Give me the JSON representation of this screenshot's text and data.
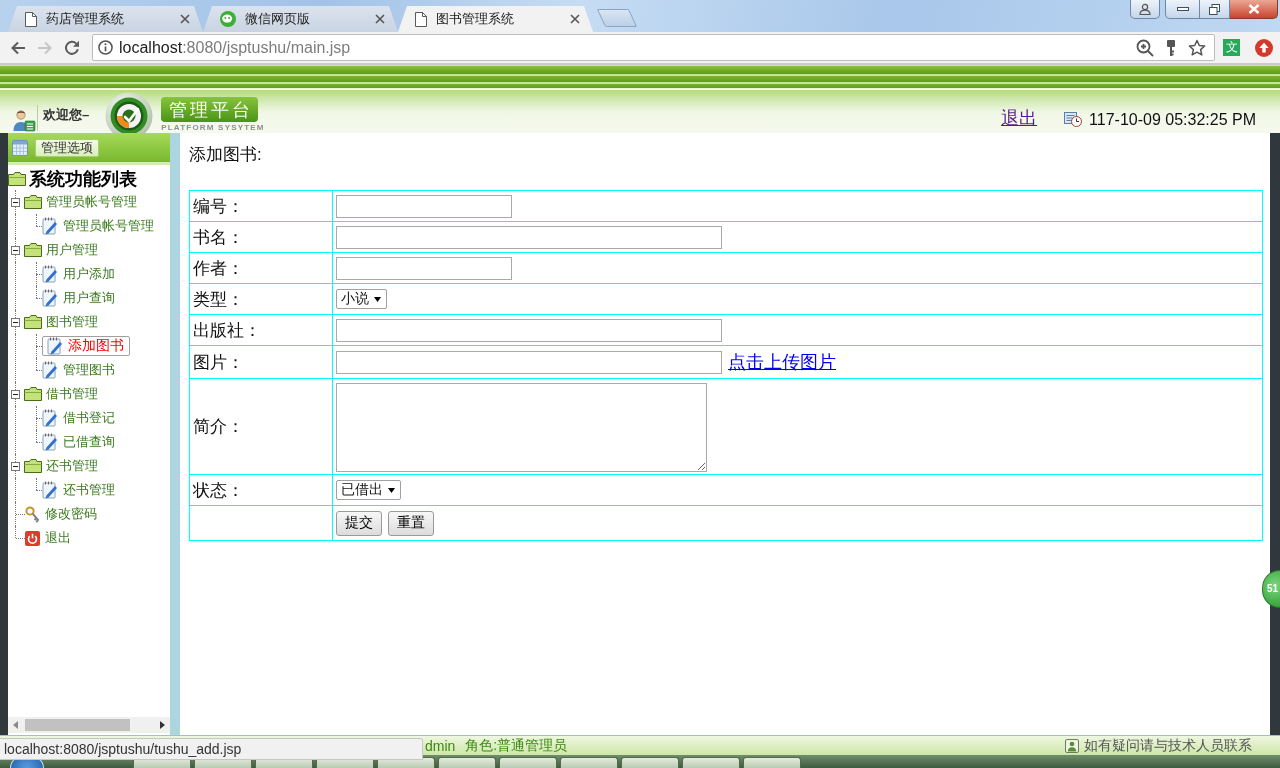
{
  "browser": {
    "tabs": [
      {
        "title": "药店管理系统",
        "kind": "page",
        "selected": false
      },
      {
        "title": "微信网页版",
        "kind": "chat",
        "selected": false
      },
      {
        "title": "图书管理系统",
        "kind": "page",
        "selected": true
      }
    ],
    "nav_buttons": [
      {
        "kind": "back",
        "disabled": false
      },
      {
        "kind": "forward",
        "disabled": true
      },
      {
        "kind": "reload",
        "disabled": false
      }
    ],
    "address": {
      "host": "localhost",
      "path": ":8080/jsptushu/main.jsp"
    },
    "extension_label": "文",
    "status_url": "localhost:8080/jsptushu/tushu_add.jsp"
  },
  "header": {
    "welcome": "欢迎您–",
    "platform_title": "管理平台",
    "platform_subtitle": "PLATFORM SYSYTEM",
    "logout_link": "退出",
    "datetime": "117-10-09 05:32:25 PM"
  },
  "sidebar": {
    "options_button": "管理选项",
    "tree_title": "系统功能列表",
    "tree": [
      {
        "label": "管理员帐号管理",
        "kind": "folder",
        "expanded": true,
        "selected": false,
        "children": [
          {
            "label": "管理员帐号管理",
            "kind": "page",
            "selected": false
          }
        ]
      },
      {
        "label": "用户管理",
        "kind": "folder",
        "expanded": true,
        "selected": false,
        "children": [
          {
            "label": "用户添加",
            "kind": "page",
            "selected": false
          },
          {
            "label": "用户查询",
            "kind": "page",
            "selected": false
          }
        ]
      },
      {
        "label": "图书管理",
        "kind": "folder",
        "expanded": true,
        "selected": false,
        "children": [
          {
            "label": "添加图书",
            "kind": "page",
            "selected": true
          },
          {
            "label": "管理图书",
            "kind": "page",
            "selected": false
          }
        ]
      },
      {
        "label": "借书管理",
        "kind": "folder",
        "expanded": true,
        "selected": false,
        "children": [
          {
            "label": "借书登记",
            "kind": "page",
            "selected": false
          },
          {
            "label": "已借查询",
            "kind": "page",
            "selected": false
          }
        ]
      },
      {
        "label": "还书管理",
        "kind": "folder",
        "expanded": true,
        "selected": false,
        "children": [
          {
            "label": "还书管理",
            "kind": "page",
            "selected": false
          }
        ]
      },
      {
        "label": "修改密码",
        "kind": "key",
        "selected": false
      },
      {
        "label": "退出",
        "kind": "exit",
        "selected": false
      }
    ]
  },
  "form": {
    "title": "添加图书:",
    "rows": [
      {
        "label": "编号：",
        "kind": "text",
        "wide": false
      },
      {
        "label": "书名：",
        "kind": "text",
        "wide": true
      },
      {
        "label": "作者：",
        "kind": "text",
        "wide": false
      },
      {
        "label": "类型：",
        "kind": "select",
        "value": "小说"
      },
      {
        "label": "出版社：",
        "kind": "text",
        "wide": true
      },
      {
        "label": "图片：",
        "kind": "upload",
        "wide": true,
        "link": "点击上传图片"
      },
      {
        "label": "简介：",
        "kind": "textarea"
      },
      {
        "label": "状态：",
        "kind": "select",
        "value": "已借出"
      },
      {
        "kind": "buttons",
        "buttons": [
          "提交",
          "重置"
        ]
      }
    ]
  },
  "footer": {
    "user": "dmin",
    "role": "角色:普通管理员",
    "notice": "如有疑问请与技术人员联系"
  },
  "floating_badge": "51"
}
